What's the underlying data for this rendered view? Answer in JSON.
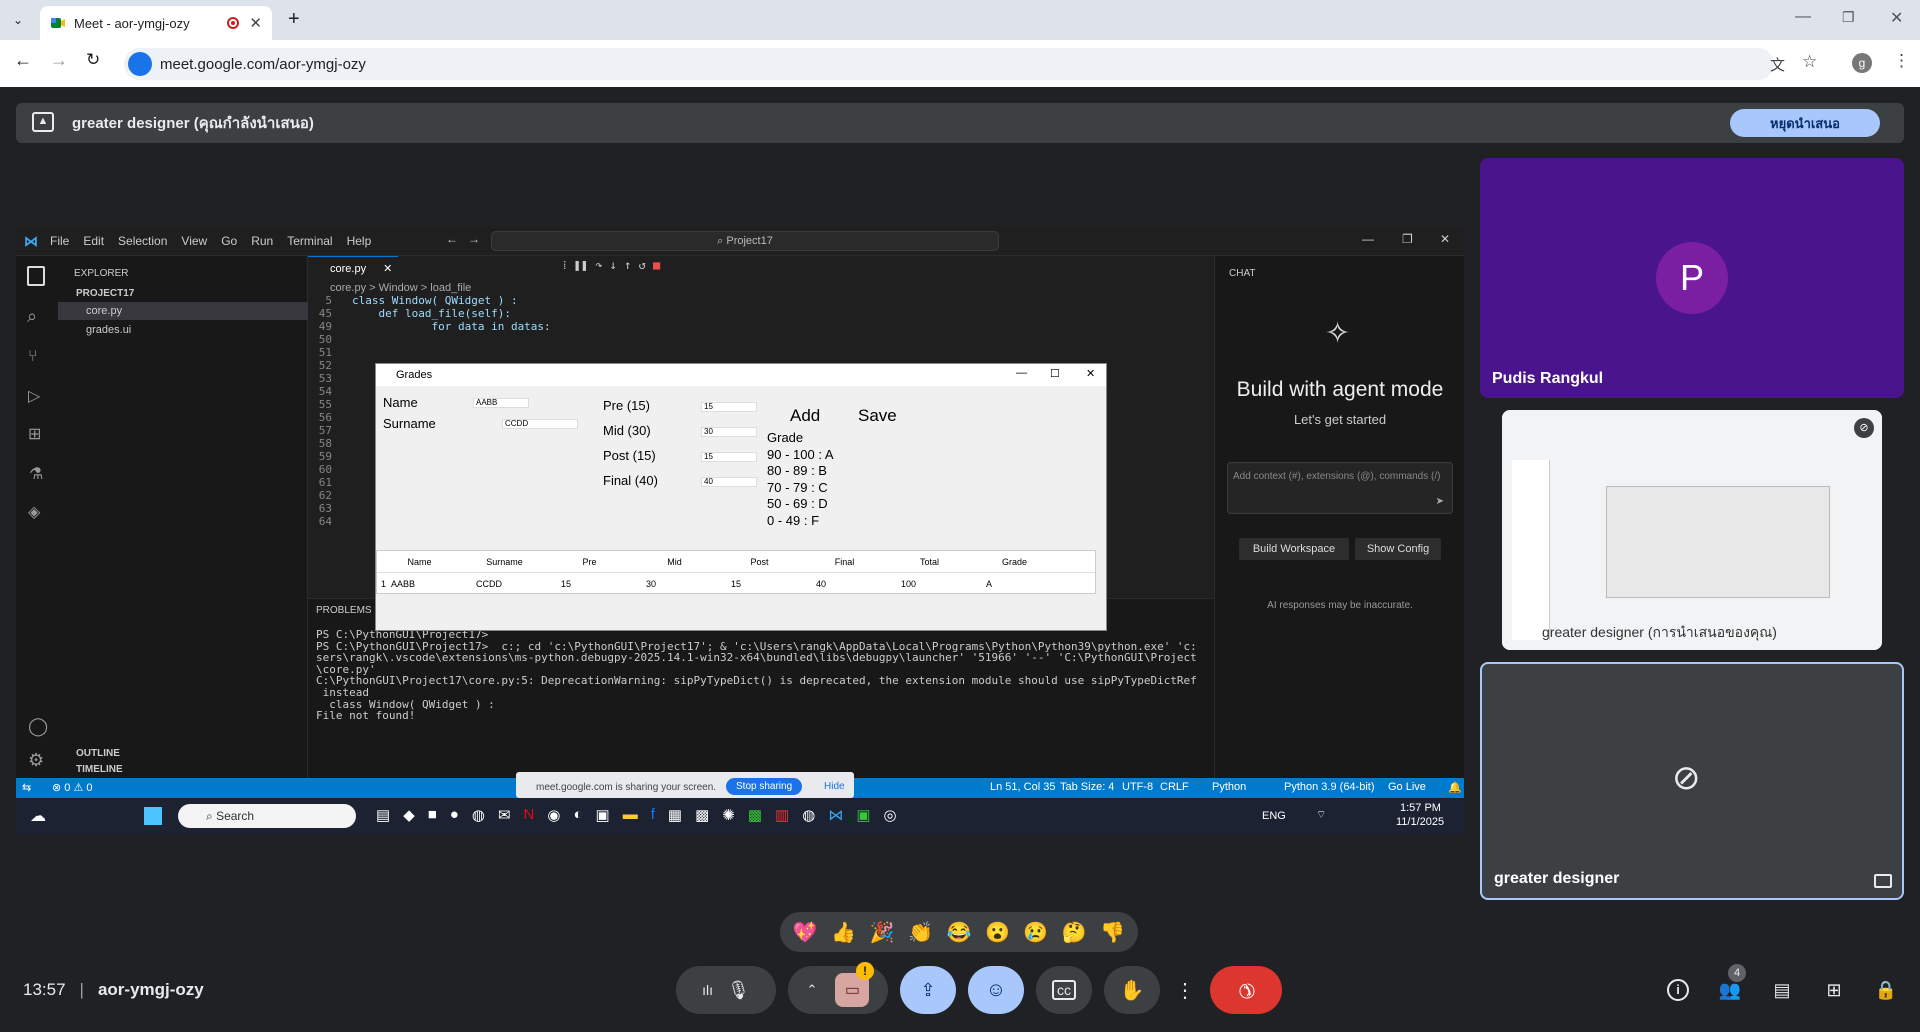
{
  "browser": {
    "tab_title": "Meet - aor-ymgj-ozy",
    "url": "meet.google.com/aor-ymgj-ozy",
    "profile_initial": "g"
  },
  "meet": {
    "presenting_label": "greater designer (คุณกำลังนำเสนอ)",
    "stop_presenting": "หยุดนำเสนอ",
    "time": "13:57",
    "meeting_code": "aor-ymgj-ozy",
    "people_count": "4",
    "participants": [
      {
        "name": "Pudis Rangkul",
        "initial": "P"
      },
      {
        "name": "greater designer (การนำเสนอของคุณ)"
      },
      {
        "name": "greater designer"
      }
    ],
    "reactions": [
      "💖",
      "👍",
      "🎉",
      "👏",
      "😂",
      "😮",
      "😢",
      "🤔",
      "👎"
    ],
    "colors": {
      "accent": "#a8c7fa",
      "end_call": "#dc362e"
    }
  },
  "vscode": {
    "menu": [
      "File",
      "Edit",
      "Selection",
      "View",
      "Go",
      "Run",
      "Terminal",
      "Help"
    ],
    "search": "Project17",
    "explorer_title": "EXPLORER",
    "project": "PROJECT17",
    "files": [
      "core.py",
      "grades.ui"
    ],
    "outline": "OUTLINE",
    "timeline": "TIMELINE",
    "tab": "core.py",
    "breadcrumb": [
      "core.py",
      "Window",
      "load_file"
    ],
    "code_lines": [
      {
        "n": "5",
        "text": "class Window( QWidget ) :"
      },
      {
        "n": "45",
        "text": "    def load_file(self):"
      },
      {
        "n": "49",
        "text": "            for data in datas:"
      },
      {
        "n": "50",
        "text": ""
      },
      {
        "n": "51",
        "text": ""
      },
      {
        "n": "52",
        "text": ""
      },
      {
        "n": "53",
        "text": ""
      },
      {
        "n": "54",
        "text": ""
      },
      {
        "n": "55",
        "text": ""
      },
      {
        "n": "56",
        "text": ""
      },
      {
        "n": "57",
        "text": ""
      },
      {
        "n": "58",
        "text": ""
      },
      {
        "n": "59",
        "text": ""
      },
      {
        "n": "60",
        "text": ""
      },
      {
        "n": "61",
        "text": ""
      },
      {
        "n": "62",
        "text": ""
      },
      {
        "n": "63",
        "text": ""
      },
      {
        "n": "64",
        "text": ""
      }
    ],
    "panel_tab": "PROBLEMS",
    "terminal": [
      "PS C:\\PythonGUI\\Project17>",
      "PS C:\\PythonGUI\\Project17>  c:; cd 'c:\\PythonGUI\\Project17'; & 'c:\\Users\\rangk\\AppData\\Local\\Programs\\Python\\Python39\\python.exe' 'c:\\U",
      "sers\\rangk\\.vscode\\extensions\\ms-python.debugpy-2025.14.1-win32-x64\\bundled\\libs\\debugpy\\launcher' '51966' '--' 'C:\\PythonGUI\\Project17",
      "\\core.py'",
      "C:\\PythonGUI\\Project17\\core.py:5: DeprecationWarning: sipPyTypeDict() is deprecated, the extension module should use sipPyTypeDictRef()",
      " instead",
      "  class Window( QWidget ) :",
      "File not found!"
    ],
    "chat": {
      "title": "CHAT",
      "heading": "Build with agent mode",
      "sub": "Let's get started",
      "placeholder": "Add context (#), extensions (@), commands (/)",
      "btn1": "Build Workspace",
      "btn2": "Show Config",
      "note": "AI responses may be inaccurate."
    },
    "status": {
      "errors": "0",
      "warnings": "0",
      "pos": "Ln 51, Col 35",
      "tab": "Tab Size: 4",
      "enc": "UTF-8",
      "eol": "CRLF",
      "lang": "Python",
      "interp": "Python 3.9 (64-bit)",
      "live": "Go Live"
    },
    "sharing_bar": "meet.google.com is sharing your screen.",
    "sharing_stop": "Stop sharing",
    "sharing_hide": "Hide"
  },
  "grades_app": {
    "title": "Grades",
    "name_label": "Name",
    "name_value": "AABB",
    "surname_label": "Surname",
    "surname_value": "CCDD",
    "pre_label": "Pre (15)",
    "pre_value": "15",
    "mid_label": "Mid (30)",
    "mid_value": "30",
    "post_label": "Post (15)",
    "post_value": "15",
    "final_label": "Final (40)",
    "final_value": "40",
    "add": "Add",
    "save": "Save",
    "grade_legend": [
      "Grade",
      "90 - 100 :  A",
      "80 - 89 :  B",
      "70 - 79 :  C",
      "50 - 69 :  D",
      "0 - 49 :  F"
    ],
    "table_headers": [
      "Name",
      "Surname",
      "Pre",
      "Mid",
      "Post",
      "Final",
      "Total",
      "Grade"
    ],
    "table_rows": [
      {
        "idx": "1",
        "cells": [
          "AABB",
          "CCDD",
          "15",
          "30",
          "15",
          "40",
          "100",
          "A"
        ]
      }
    ]
  },
  "taskbar": {
    "search": "Search",
    "lang": "ENG",
    "time": "1:57 PM",
    "date": "11/1/2025"
  }
}
